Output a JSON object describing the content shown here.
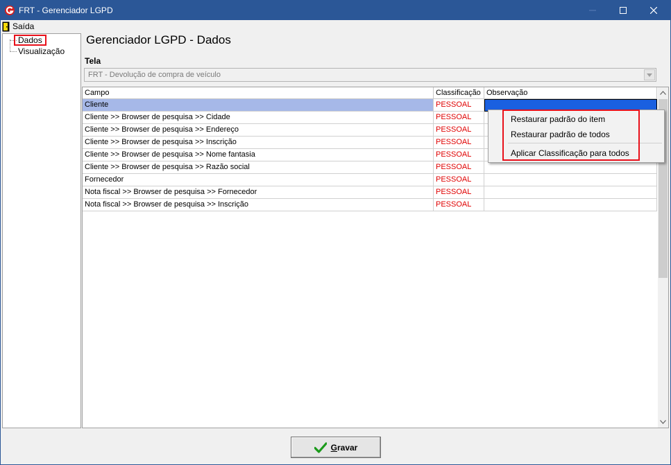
{
  "window": {
    "title": "FRT - Gerenciador LGPD",
    "titlebar_color": "#2b5797"
  },
  "menubar": {
    "exit_label": "Saída"
  },
  "tree": {
    "items": [
      {
        "label": "Dados",
        "selected": true
      },
      {
        "label": "Visualização",
        "selected": false
      }
    ]
  },
  "page": {
    "title": "Gerenciador LGPD - Dados",
    "tela_label": "Tela",
    "tela_value": "FRT - Devolução de compra de veículo"
  },
  "grid": {
    "columns": [
      "Campo",
      "Classificação",
      "Observação"
    ],
    "rows": [
      {
        "campo": "Cliente",
        "classificacao": "PESSOAL",
        "observacao": ""
      },
      {
        "campo": "Cliente >> Browser de pesquisa >> Cidade",
        "classificacao": "PESSOAL",
        "observacao": ""
      },
      {
        "campo": "Cliente >> Browser de pesquisa >> Endereço",
        "classificacao": "PESSOAL",
        "observacao": ""
      },
      {
        "campo": "Cliente >> Browser de pesquisa >> Inscrição",
        "classificacao": "PESSOAL",
        "observacao": ""
      },
      {
        "campo": "Cliente >> Browser de pesquisa >> Nome fantasia",
        "classificacao": "PESSOAL",
        "observacao": ""
      },
      {
        "campo": "Cliente >> Browser de pesquisa >> Razão social",
        "classificacao": "PESSOAL",
        "observacao": ""
      },
      {
        "campo": "Fornecedor",
        "classificacao": "PESSOAL",
        "observacao": ""
      },
      {
        "campo": "Nota fiscal >> Browser de pesquisa >> Fornecedor",
        "classificacao": "PESSOAL",
        "observacao": ""
      },
      {
        "campo": "Nota fiscal >> Browser de pesquisa >> Inscrição",
        "classificacao": "PESSOAL",
        "observacao": ""
      }
    ],
    "classification_color": "#e00000"
  },
  "context_menu": {
    "items": [
      "Restaurar padrão do item",
      "Restaurar padrão de todos",
      "Aplicar Classificação para todos"
    ]
  },
  "footer": {
    "save_label_prefix": "G",
    "save_label_rest": "ravar"
  },
  "highlight_color": "#e8101a"
}
